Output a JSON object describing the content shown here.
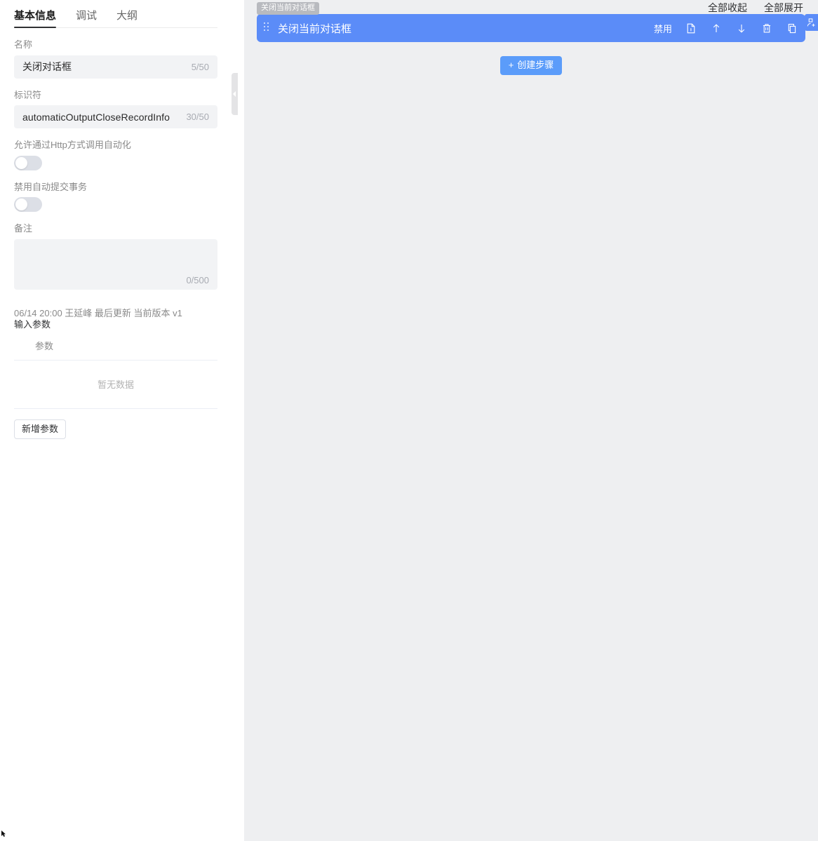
{
  "left": {
    "tabs": [
      {
        "label": "基本信息",
        "active": true
      },
      {
        "label": "调试",
        "active": false
      },
      {
        "label": "大纲",
        "active": false
      }
    ],
    "name_label": "名称",
    "name_value": "关闭对话框",
    "name_counter": "5/50",
    "identifier_label": "标识符",
    "identifier_value": "automaticOutputCloseRecordInfo",
    "identifier_counter": "30/50",
    "http_label": "允许通过Http方式调用自动化",
    "http_enabled": false,
    "disable_autocommit_label": "禁用自动提交事务",
    "disable_autocommit_enabled": false,
    "remark_label": "备注",
    "remark_value": "",
    "remark_counter": "0/500",
    "meta_text": "06/14 20:00 王延峰 最后更新 当前版本 v1",
    "input_params_title": "输入参数",
    "param_column_header": "参数",
    "empty_text": "暂无数据",
    "add_param_label": "新增参数"
  },
  "splitter": {
    "collapse_icon": "chevron-left-icon"
  },
  "right": {
    "topbar_links": [
      {
        "label": "全部收起",
        "name": "collapse-all"
      },
      {
        "label": "全部展开",
        "name": "expand-all"
      }
    ],
    "tooltip_text": "关闭当前对话框",
    "step": {
      "title": "关闭当前对话框",
      "disable_label": "禁用",
      "actions": [
        {
          "name": "document-icon",
          "title": "文档"
        },
        {
          "name": "arrow-up-icon",
          "title": "上移"
        },
        {
          "name": "arrow-down-icon",
          "title": "下移"
        },
        {
          "name": "trash-icon",
          "title": "删除"
        },
        {
          "name": "copy-icon",
          "title": "复制"
        }
      ]
    },
    "side_fab_icon": "add-user-icon",
    "create_step": {
      "plus": "+",
      "label": "创建步骤"
    }
  },
  "colors": {
    "accent_blue": "#5b8cf8",
    "button_blue": "#5b9cfa",
    "canvas_bg": "#eeeff1",
    "field_bg": "#f2f3f5",
    "tooltip_bg": "#b8babf"
  }
}
